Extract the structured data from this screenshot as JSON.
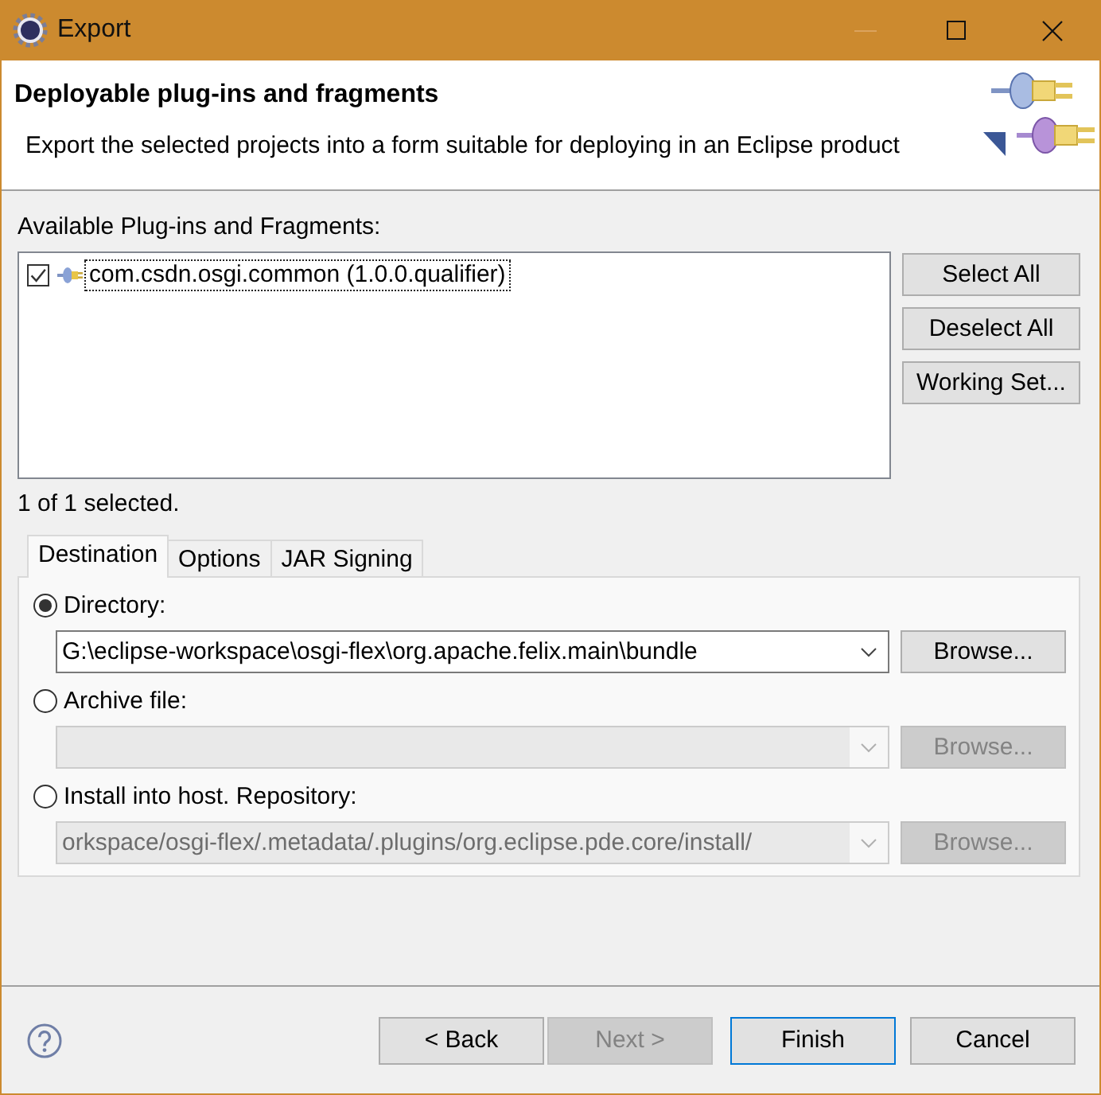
{
  "window": {
    "title": "Export"
  },
  "header": {
    "title": "Deployable plug-ins and fragments",
    "description": "Export the selected projects into a form suitable for deploying in an Eclipse product"
  },
  "plugins": {
    "label": "Available Plug-ins and Fragments:",
    "items": [
      {
        "label": "com.csdn.osgi.common (1.0.0.qualifier)",
        "checked": true,
        "focused": true
      }
    ],
    "buttons": [
      "Select All",
      "Deselect All",
      "Working Set..."
    ],
    "status": "1 of 1 selected."
  },
  "tabs": [
    {
      "label": "Destination",
      "selected": true
    },
    {
      "label": "Options",
      "selected": false
    },
    {
      "label": "JAR Signing",
      "selected": false
    }
  ],
  "destinations": [
    {
      "label": "Directory:",
      "selected": true,
      "value": "G:\\eclipse-workspace\\osgi-flex\\org.apache.felix.main\\bundle",
      "button": "Browse...",
      "disabled": false
    },
    {
      "label": "Archive file:",
      "selected": false,
      "button": "Browse...",
      "disabled": true
    },
    {
      "label": "Install into host. Repository:",
      "selected": false,
      "value": "orkspace/osgi-flex/.metadata/.plugins/org.eclipse.pde.core/install/",
      "button": "Browse...",
      "disabled": true
    }
  ],
  "footer": {
    "buttons": [
      {
        "label": "< Back",
        "disabled": false,
        "default": false
      },
      {
        "label": "Next >",
        "disabled": true,
        "default": false
      },
      {
        "label": "Finish",
        "disabled": false,
        "default": true
      },
      {
        "label": "Cancel",
        "disabled": false,
        "default": false
      }
    ]
  }
}
